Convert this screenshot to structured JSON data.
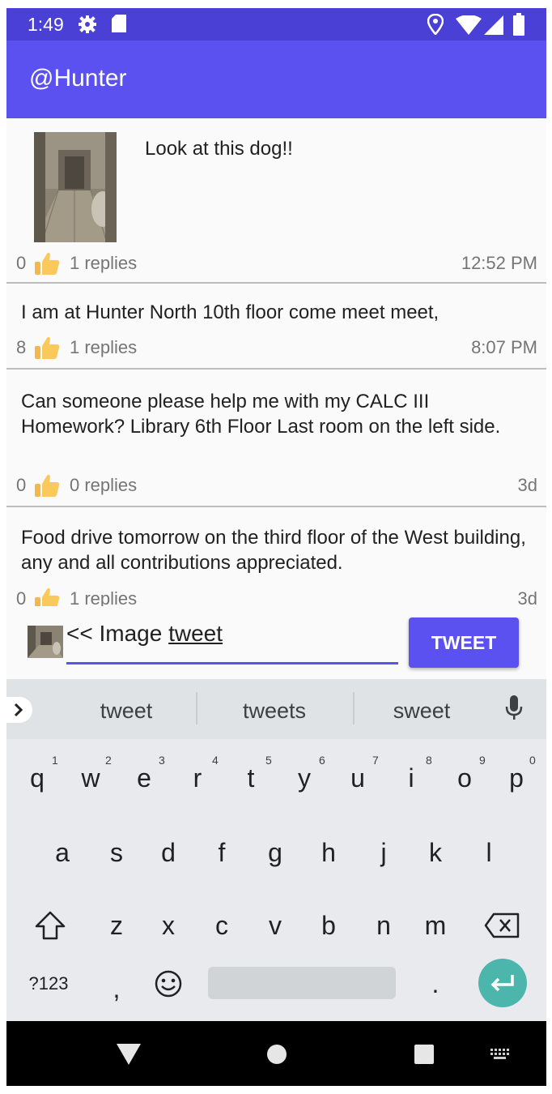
{
  "status_bar": {
    "time": "1:49"
  },
  "app_bar": {
    "title": "@Hunter"
  },
  "posts": [
    {
      "text": "Look at this dog!!",
      "likes": "0",
      "replies": "1 replies",
      "time": "12:52 PM"
    },
    {
      "text": "I am at Hunter North 10th floor come meet meet,",
      "likes": "8",
      "replies": "1 replies",
      "time": "8:07 PM"
    },
    {
      "text": "Can someone please help me with my CALC III Homework? Library 6th Floor Last room on the left side.",
      "likes": "0",
      "replies": "0 replies",
      "time": "3d"
    },
    {
      "text": "Food drive tomorrow on the third floor of the West building, any and all contributions appreciated.",
      "likes": "0",
      "replies": "1 replies",
      "time": "3d"
    }
  ],
  "compose": {
    "prefix": "<< Image ",
    "word": "tweet",
    "button": "TWEET"
  },
  "keyboard": {
    "suggestions": [
      "tweet",
      "tweets",
      "sweet"
    ],
    "row1": [
      "q",
      "w",
      "e",
      "r",
      "t",
      "y",
      "u",
      "i",
      "o",
      "p"
    ],
    "row1_hints": [
      "1",
      "2",
      "3",
      "4",
      "5",
      "6",
      "7",
      "8",
      "9",
      "0"
    ],
    "row2": [
      "a",
      "s",
      "d",
      "f",
      "g",
      "h",
      "j",
      "k",
      "l"
    ],
    "row3": [
      "z",
      "x",
      "c",
      "v",
      "b",
      "n",
      "m"
    ],
    "symbols_key": "?123",
    "comma_key": ",",
    "period_key": "."
  },
  "colors": {
    "app_bar": "#5b50f0",
    "status_bar": "#4a40d6",
    "accent": "#5b50f0",
    "enter_key": "#4db6ac"
  },
  "icons": [
    "settings-icon",
    "sd-card-icon",
    "location-icon",
    "wifi-icon",
    "signal-icon",
    "battery-icon",
    "thumbs-up-icon",
    "mic-icon",
    "shift-icon",
    "backspace-icon",
    "emoji-icon",
    "enter-icon",
    "back-icon",
    "home-icon",
    "recents-icon",
    "keyboard-switch-icon"
  ]
}
